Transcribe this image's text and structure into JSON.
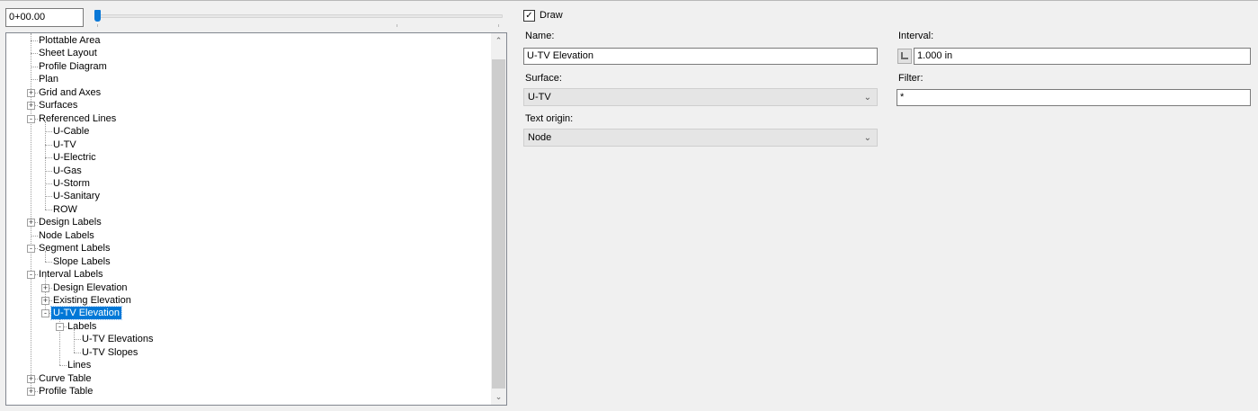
{
  "station": {
    "value": "0+00.00"
  },
  "tree": {
    "items": [
      {
        "label": "Plottable Area",
        "level": 0,
        "expander": ""
      },
      {
        "label": "Sheet Layout",
        "level": 0,
        "expander": ""
      },
      {
        "label": "Profile Diagram",
        "level": 0,
        "expander": ""
      },
      {
        "label": "Plan",
        "level": 0,
        "expander": ""
      },
      {
        "label": "Grid and Axes",
        "level": 0,
        "expander": "+"
      },
      {
        "label": "Surfaces",
        "level": 0,
        "expander": "+"
      },
      {
        "label": "Referenced Lines",
        "level": 0,
        "expander": "-"
      },
      {
        "label": "U-Cable",
        "level": 1,
        "expander": ""
      },
      {
        "label": "U-TV",
        "level": 1,
        "expander": ""
      },
      {
        "label": "U-Electric",
        "level": 1,
        "expander": ""
      },
      {
        "label": "U-Gas",
        "level": 1,
        "expander": ""
      },
      {
        "label": "U-Storm",
        "level": 1,
        "expander": ""
      },
      {
        "label": "U-Sanitary",
        "level": 1,
        "expander": ""
      },
      {
        "label": "ROW",
        "level": 1,
        "expander": ""
      },
      {
        "label": "Design Labels",
        "level": 0,
        "expander": "+"
      },
      {
        "label": "Node Labels",
        "level": 0,
        "expander": ""
      },
      {
        "label": "Segment Labels",
        "level": 0,
        "expander": "-"
      },
      {
        "label": "Slope Labels",
        "level": 1,
        "expander": ""
      },
      {
        "label": "Interval Labels",
        "level": 0,
        "expander": "-"
      },
      {
        "label": "Design Elevation",
        "level": 1,
        "expander": "+"
      },
      {
        "label": "Existing Elevation",
        "level": 1,
        "expander": "+"
      },
      {
        "label": "U-TV Elevation",
        "level": 1,
        "expander": "-",
        "selected": true
      },
      {
        "label": "Labels",
        "level": 2,
        "expander": "-"
      },
      {
        "label": "U-TV Elevations",
        "level": 3,
        "expander": ""
      },
      {
        "label": "U-TV Slopes",
        "level": 3,
        "expander": ""
      },
      {
        "label": "Lines",
        "level": 2,
        "expander": ""
      },
      {
        "label": "Curve Table",
        "level": 0,
        "expander": "+"
      },
      {
        "label": "Profile Table",
        "level": 0,
        "expander": "+"
      }
    ],
    "scroll_up": "⌃",
    "scroll_down": "⌄"
  },
  "properties": {
    "draw": {
      "label": "Draw",
      "checked": true,
      "check_glyph": "✓"
    },
    "name": {
      "label": "Name:",
      "value": "U-TV Elevation"
    },
    "interval": {
      "label": "Interval:",
      "value": "1.000 in"
    },
    "surface": {
      "label": "Surface:",
      "value": "U-TV"
    },
    "filter": {
      "label": "Filter:",
      "value": "*"
    },
    "text_origin": {
      "label": "Text origin:",
      "value": "Node"
    },
    "dropdown_glyph": "⌄"
  },
  "colors": {
    "selection": "#0078d7",
    "slider": "#0a78d7",
    "background": "#f0f0f0"
  }
}
